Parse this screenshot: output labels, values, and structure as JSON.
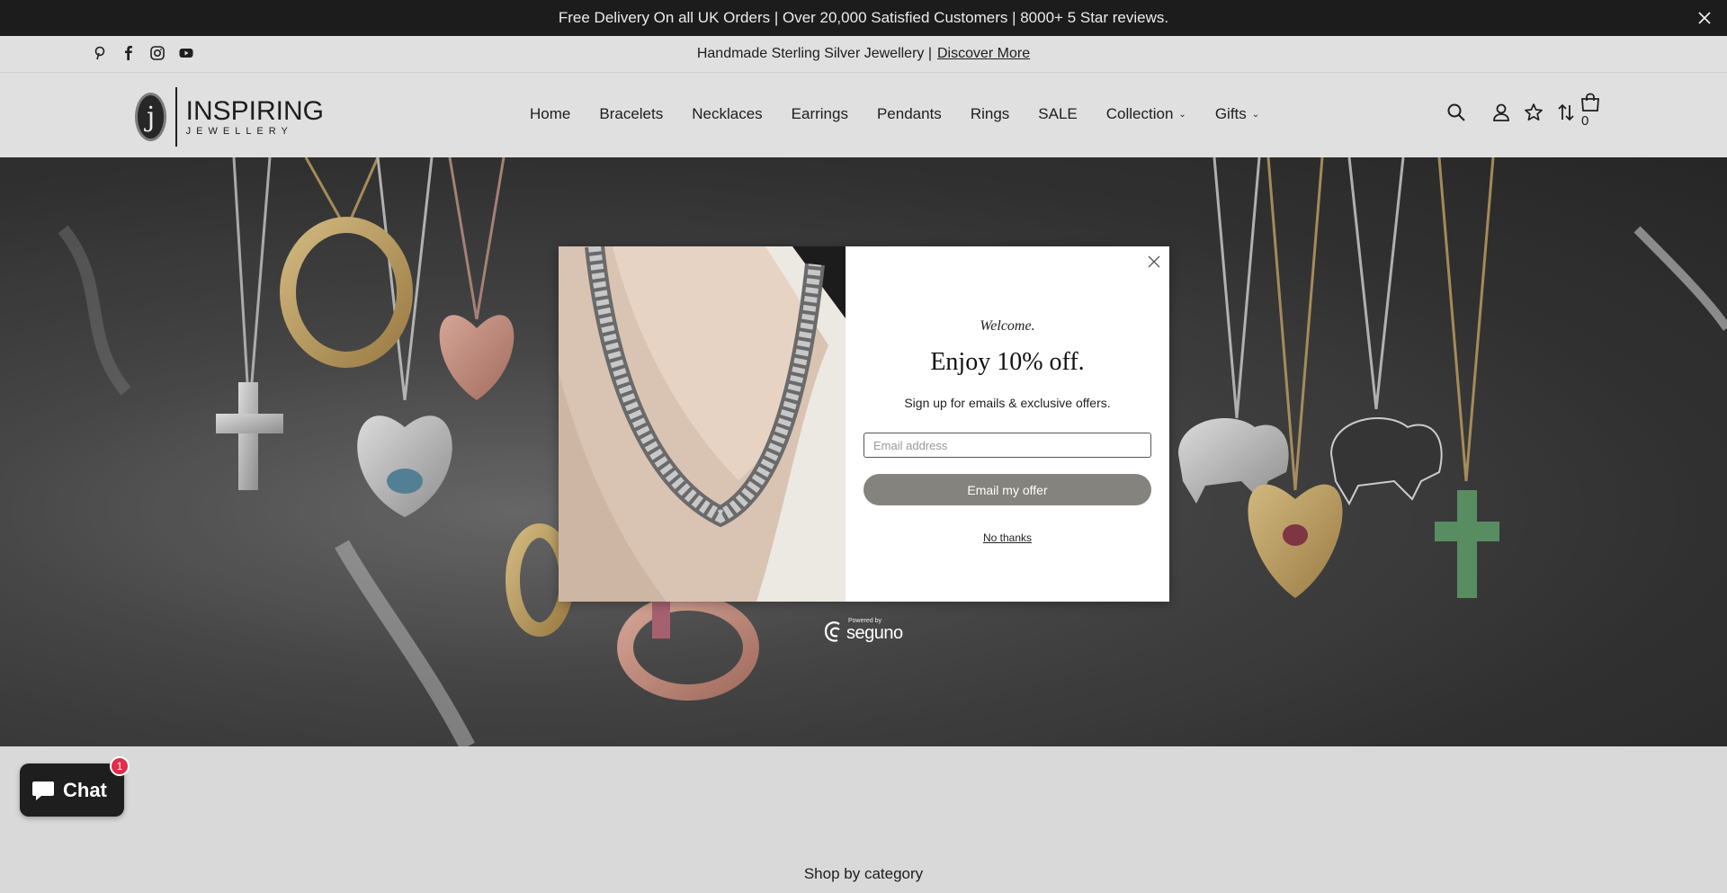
{
  "announcement": {
    "text": "Free Delivery On all UK Orders | Over 20,000 Satisfied Customers | 8000+ 5 Star reviews."
  },
  "subbar": {
    "text": "Handmade Sterling Silver Jewellery |",
    "link": "Discover More",
    "socials": [
      "pinterest-icon",
      "facebook-icon",
      "instagram-icon",
      "youtube-icon"
    ]
  },
  "logo": {
    "mark": "j",
    "line1": "INSPIRING",
    "line2": "JEWELLERY"
  },
  "nav": {
    "items": [
      "Home",
      "Bracelets",
      "Necklaces",
      "Earrings",
      "Pendants",
      "Rings",
      "SALE",
      "Collection",
      "Gifts"
    ]
  },
  "header_icons": [
    "search-icon",
    "account-icon",
    "wishlist-star-icon",
    "compare-icon",
    "cart-icon"
  ],
  "cart": {
    "count": "0"
  },
  "popup": {
    "welcome": "Welcome.",
    "headline": "Enjoy 10% off.",
    "subline": "Sign up for emails & exclusive offers.",
    "email_placeholder": "Email address",
    "button": "Email my offer",
    "decline": "No thanks",
    "powered_by": "Powered by",
    "brand": "seguno"
  },
  "section": {
    "shop_by_category": "Shop by category"
  },
  "chat": {
    "label": "Chat",
    "badge": "1"
  },
  "colors": {
    "announce_bg": "#1f1f1f",
    "offer_button": "#85837d",
    "chat_bg": "#1e1e1e",
    "badge": "#e32b4a"
  }
}
